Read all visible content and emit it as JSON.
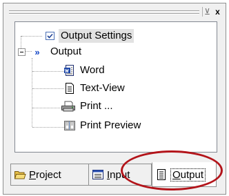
{
  "window": {
    "pin_glyph": "⊻",
    "close_glyph": "x"
  },
  "tree": {
    "items": [
      {
        "label": "Output Settings",
        "icon": "checkbox-icon",
        "selected": true
      },
      {
        "label": "Output",
        "icon": "double-arrow-icon",
        "expanded": true
      },
      {
        "label": "Word",
        "icon": "word-document-icon"
      },
      {
        "label": "Text-View",
        "icon": "text-document-icon"
      },
      {
        "label": "Print ...",
        "icon": "printer-icon"
      },
      {
        "label": "Print Preview",
        "icon": "print-preview-icon"
      }
    ]
  },
  "tabs": [
    {
      "label": "Project",
      "mnemonic": "P",
      "rest": "roject",
      "icon": "folder-open-icon",
      "active": false
    },
    {
      "label": "Input",
      "mnemonic": "I",
      "rest": "nput",
      "icon": "input-form-icon",
      "active": false
    },
    {
      "label": "Output",
      "mnemonic": "O",
      "rest": "utput",
      "icon": "output-document-icon",
      "active": true
    }
  ],
  "colors": {
    "highlight_circle": "#b3141a",
    "selected_background": "#e2e2e2",
    "arrow_blue": "#1447c7"
  }
}
